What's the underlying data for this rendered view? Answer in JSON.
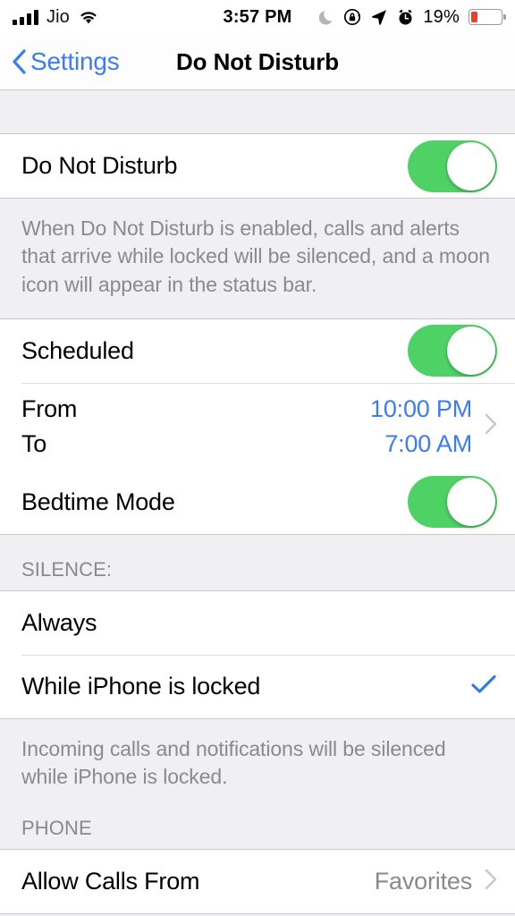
{
  "status_bar": {
    "carrier": "Jio",
    "signal_bars": 4,
    "time": "3:57 PM",
    "battery_percent": "19%",
    "icons": [
      "moon-icon",
      "rotation-lock-icon",
      "location-arrow-icon",
      "alarm-clock-icon"
    ],
    "battery_color": "#ef3d2f"
  },
  "nav": {
    "back_label": "Settings",
    "title": "Do Not Disturb"
  },
  "colors": {
    "accent_blue": "#3c7bf6",
    "toggle_on_green": "#4fd265",
    "group_background": "#ffffff",
    "page_background": "#efeff4",
    "secondary_text": "#8a8a8e"
  },
  "sections": {
    "dnd": {
      "row_label": "Do Not Disturb",
      "toggle_state": "on",
      "footer": "When Do Not Disturb is enabled, calls and alerts that arrive while locked will be silenced, and a moon icon will appear in the status bar."
    },
    "schedule": {
      "scheduled_label": "Scheduled",
      "scheduled_toggle": "on",
      "from_label": "From",
      "from_value": "10:00 PM",
      "to_label": "To",
      "to_value": "7:00 AM",
      "bedtime_label": "Bedtime Mode",
      "bedtime_toggle": "on"
    },
    "silence": {
      "header": "SILENCE:",
      "options": [
        {
          "label": "Always",
          "selected": false
        },
        {
          "label": "While iPhone is locked",
          "selected": true
        }
      ],
      "footer": "Incoming calls and notifications will be silenced while iPhone is locked."
    },
    "phone": {
      "header": "PHONE",
      "row_label": "Allow Calls From",
      "row_value": "Favorites"
    }
  }
}
